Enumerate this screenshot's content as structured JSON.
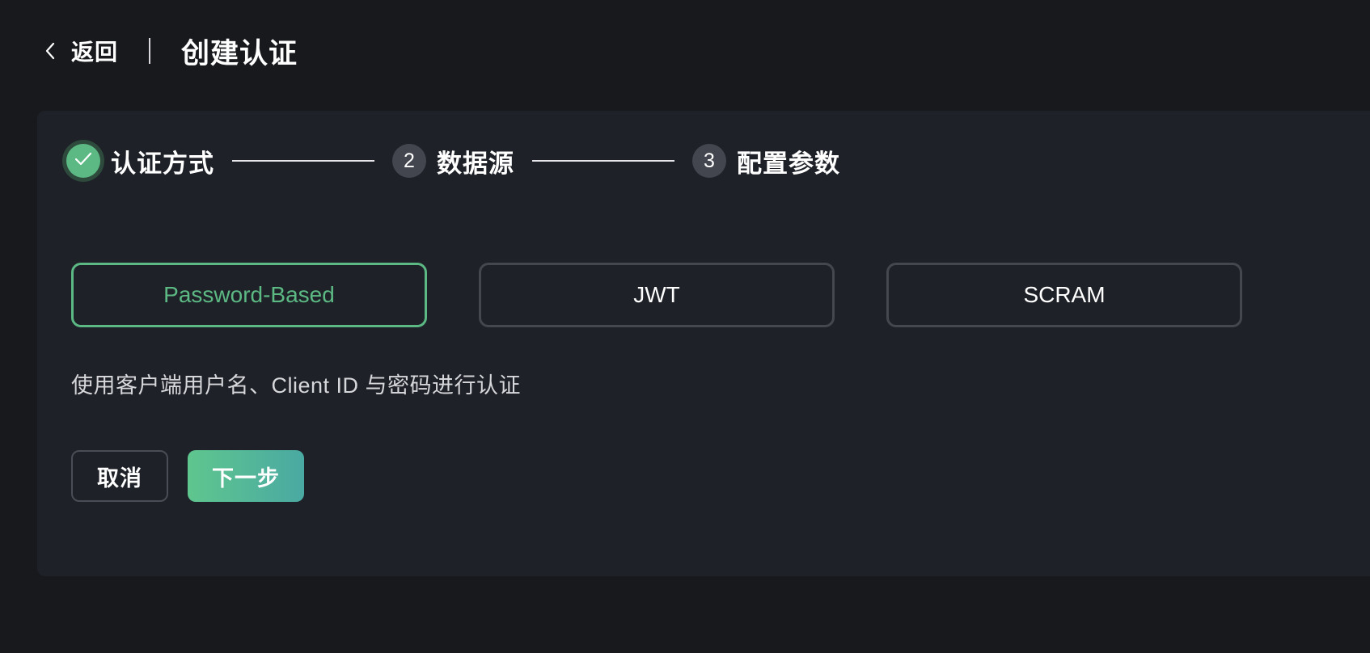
{
  "header": {
    "back_label": "返回",
    "title": "创建认证"
  },
  "steps": [
    {
      "number": "1",
      "label": "认证方式",
      "status": "completed"
    },
    {
      "number": "2",
      "label": "数据源",
      "status": "pending"
    },
    {
      "number": "3",
      "label": "配置参数",
      "status": "pending"
    }
  ],
  "options": [
    {
      "label": "Password-Based",
      "selected": true
    },
    {
      "label": "JWT",
      "selected": false
    },
    {
      "label": "SCRAM",
      "selected": false
    }
  ],
  "description": "使用客户端用户名、Client ID 与密码进行认证",
  "actions": {
    "cancel_label": "取消",
    "next_label": "下一步"
  },
  "icons": {
    "back": "chevron-left-icon",
    "step_done": "check-icon"
  },
  "colors": {
    "background": "#17191d",
    "card": "#1e2128",
    "accent": "#5cb984",
    "accent_gradient_end": "#4aa9a2",
    "border": "#44474e"
  }
}
